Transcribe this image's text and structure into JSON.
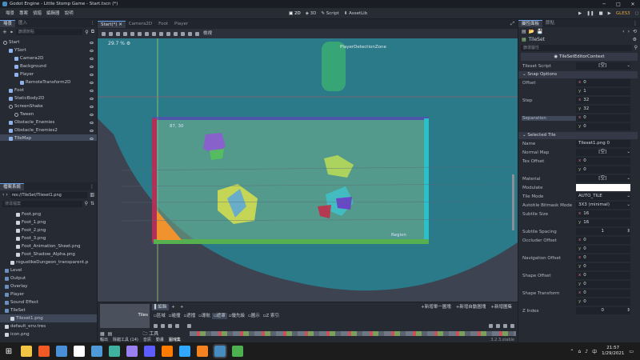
{
  "window": {
    "title": "Godot Engine - Little Stomp Game - Start.tscn (*)"
  },
  "menu": {
    "items": [
      "場景",
      "專案",
      "偵錯",
      "編輯器",
      "說明"
    ],
    "workspaces": [
      "2D",
      "3D",
      "Script",
      "AssetLib"
    ],
    "gles": "GLES3"
  },
  "scene_dock": {
    "tabs": [
      "場景",
      "匯入"
    ],
    "filter_placeholder": "篩選節點",
    "nodes": [
      {
        "label": "Start",
        "indent": 0,
        "icon": "node"
      },
      {
        "label": "YSort",
        "indent": 1,
        "icon": "b"
      },
      {
        "label": "Camera2D",
        "indent": 2,
        "icon": "b"
      },
      {
        "label": "Background",
        "indent": 2,
        "icon": "b"
      },
      {
        "label": "Player",
        "indent": 2,
        "icon": "b"
      },
      {
        "label": "RemoteTransform2D",
        "indent": 3,
        "icon": "b"
      },
      {
        "label": "Foot",
        "indent": 1,
        "icon": "b"
      },
      {
        "label": "StaticBody2D",
        "indent": 1,
        "icon": "b"
      },
      {
        "label": "ScreenShake",
        "indent": 1,
        "icon": "node"
      },
      {
        "label": "Tween",
        "indent": 2,
        "icon": "node"
      },
      {
        "label": "Obstacle_Enemies",
        "indent": 1,
        "icon": "b"
      },
      {
        "label": "Obstacle_Enemies2",
        "indent": 1,
        "icon": "b"
      },
      {
        "label": "TileMap",
        "indent": 1,
        "icon": "b"
      }
    ]
  },
  "fs_dock": {
    "title": "檔案系統",
    "path": "res://TileSet/Tileset1.png",
    "search_placeholder": "搜尋檔案",
    "files": [
      {
        "label": "Foot.png",
        "indent": 2,
        "type": "file"
      },
      {
        "label": "Foot_1.png",
        "indent": 2,
        "type": "file"
      },
      {
        "label": "Foot_2.png",
        "indent": 2,
        "type": "file"
      },
      {
        "label": "Foot_3.png",
        "indent": 2,
        "type": "file"
      },
      {
        "label": "Foot_Animation_Sheet.png",
        "indent": 2,
        "type": "file"
      },
      {
        "label": "Foot_Shadow_Alpha.png",
        "indent": 2,
        "type": "file"
      },
      {
        "label": "roguelikeDungeon_transparent.p",
        "indent": 1,
        "type": "file"
      },
      {
        "label": "Level",
        "indent": 0,
        "type": "folder"
      },
      {
        "label": "Output",
        "indent": 0,
        "type": "folder"
      },
      {
        "label": "Overlay",
        "indent": 0,
        "type": "folder"
      },
      {
        "label": "Player",
        "indent": 0,
        "type": "folder"
      },
      {
        "label": "Sound Effect",
        "indent": 0,
        "type": "folder"
      },
      {
        "label": "TileSet",
        "indent": 0,
        "type": "folder"
      },
      {
        "label": "Tileset1.png",
        "indent": 1,
        "type": "file"
      },
      {
        "label": "default_env.tres",
        "indent": 0,
        "type": "file"
      },
      {
        "label": "icon.png",
        "indent": 0,
        "type": "file"
      }
    ]
  },
  "editor": {
    "tabs": [
      "Start(*)",
      "Camera2D",
      "Foot",
      "Player"
    ],
    "toolbar_mode": "檢視",
    "zoom": "29.7 %",
    "canvas_labels": {
      "detection": "PlayerDetectionZone",
      "tile_left": "87, 30",
      "tile_right": "Region"
    }
  },
  "tileset_panel": {
    "tab_edit": "編輯",
    "tools": [
      "區域",
      "碰撞",
      "遮擋",
      "導航",
      "遮罩",
      "優先級",
      "圖示",
      "Z 索引"
    ],
    "buttons": [
      "新增單一圖塊",
      "新增自動圖塊",
      "新增圖集"
    ],
    "tile_label": "Tiles",
    "bottom_tabs": [
      "輸出",
      "除錯工具 (14)",
      "音訊",
      "動畫",
      "圖塊集"
    ],
    "version": "3.2.3.stable"
  },
  "inspector": {
    "tabs": [
      "屬性面板",
      "節點"
    ],
    "resource": "TileSet",
    "filter_placeholder": "篩選屬性",
    "context": "TileSetEditorContext",
    "tileset_script_label": "Tileset Script",
    "tileset_script_value": "[空]",
    "snap_section": "Snap Options",
    "offset_label": "Offset",
    "offset_x": "0",
    "offset_y": "1",
    "step_label": "Step",
    "step_x": "32",
    "step_y": "32",
    "separation_label": "Separation",
    "separation_x": "0",
    "separation_y": "0",
    "selected_section": "Selected Tile",
    "name_label": "Name",
    "name_value": "Tileset1.png 0",
    "normal_map_label": "Normal Map",
    "normal_map_value": "[空]",
    "tex_offset_label": "Tex Offset",
    "tex_offset_x": "0",
    "tex_offset_y": "0",
    "material_label": "Material",
    "material_value": "[空]",
    "modulate_label": "Modulate",
    "tile_mode_label": "Tile Mode",
    "tile_mode_value": "AUTO_TILE",
    "bitmask_label": "Autotile Bitmask Mode",
    "bitmask_value": "3X3 (minimal)",
    "subtile_size_label": "Subtile Size",
    "subtile_size_x": "16",
    "subtile_size_y": "16",
    "subtile_spacing_label": "Subtile Spacing",
    "subtile_spacing_value": "1",
    "occluder_label": "Occluder Offset",
    "occluder_x": "0",
    "occluder_y": "0",
    "nav_label": "Navigation Offset",
    "nav_x": "0",
    "nav_y": "0",
    "shape_offset_label": "Shape Offset",
    "shape_offset_x": "0",
    "shape_offset_y": "0",
    "shape_transform_label": "Shape Transform",
    "shape_transform_x": "0",
    "shape_transform_y": "0",
    "z_index_label": "Z Index",
    "z_index_value": "0"
  },
  "taskbar": {
    "time": "21:57",
    "date": "1/29/2021",
    "apps": [
      "file-explorer",
      "brave",
      "mail",
      "notion",
      "blender-sub",
      "affinity",
      "premiere",
      "after-effects",
      "illustrator",
      "photoshop",
      "blender",
      "godot",
      "chrome"
    ]
  },
  "colors": {
    "accent": "#6aa2ef",
    "teal": "#2a7a8a",
    "region_border": "#6a3cc4",
    "grid_green": "#7bc96f"
  }
}
